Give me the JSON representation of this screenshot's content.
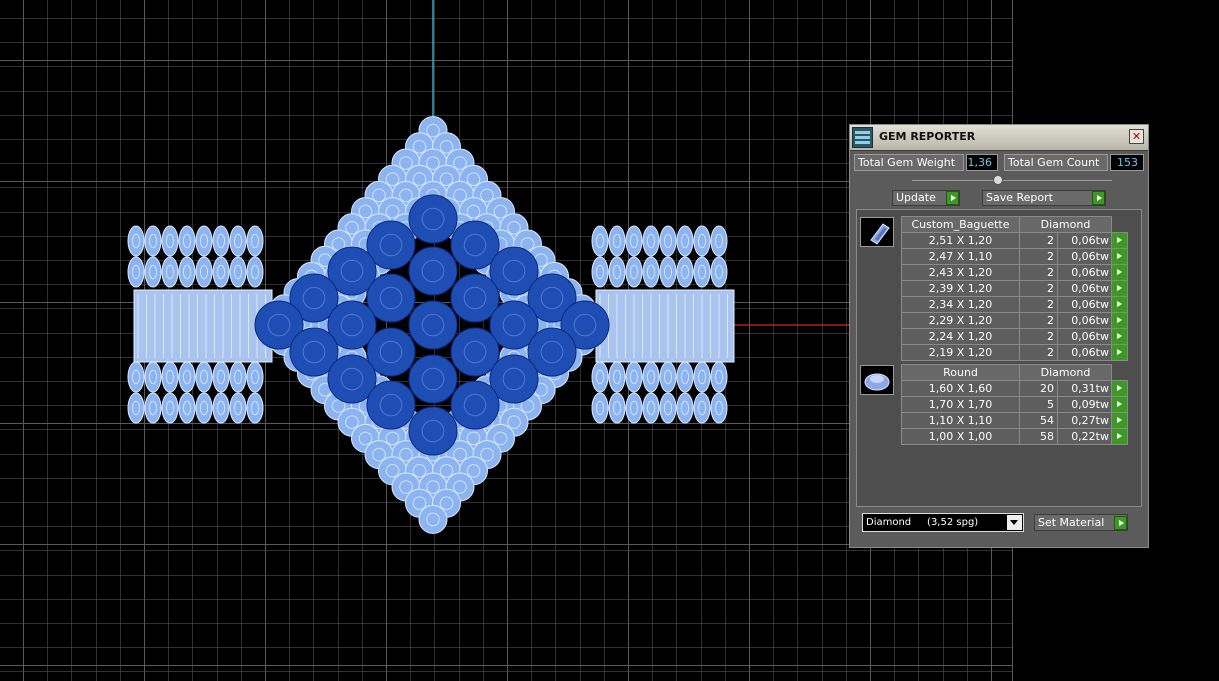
{
  "panel": {
    "title": "GEM REPORTER",
    "close_glyph": "✕",
    "total_weight_label": "Total Gem Weight",
    "total_weight_value": "1,36",
    "total_count_label": "Total Gem Count",
    "total_count_value": "153",
    "update_label": "Update",
    "save_label": "Save Report",
    "set_material_label": "Set Material",
    "material_value": "Diamond     (3,52 spg)"
  },
  "groups": [
    {
      "shape": "Custom_Baguette",
      "material": "Diamond",
      "icon": "baguette-gem-icon",
      "rows": [
        {
          "size": "2,51 X 1,20",
          "count": "2",
          "weight": "0,06tw"
        },
        {
          "size": "2,47 X 1,10",
          "count": "2",
          "weight": "0,06tw"
        },
        {
          "size": "2,43 X 1,20",
          "count": "2",
          "weight": "0,06tw"
        },
        {
          "size": "2,39 X 1,20",
          "count": "2",
          "weight": "0,06tw"
        },
        {
          "size": "2,34 X 1,20",
          "count": "2",
          "weight": "0,06tw"
        },
        {
          "size": "2,29 X 1,20",
          "count": "2",
          "weight": "0,06tw"
        },
        {
          "size": "2,24 X 1,20",
          "count": "2",
          "weight": "0,06tw"
        },
        {
          "size": "2,19 X 1,20",
          "count": "2",
          "weight": "0,06tw"
        }
      ]
    },
    {
      "shape": "Round",
      "material": "Diamond",
      "icon": "round-gem-icon",
      "rows": [
        {
          "size": "1,60 X 1,60",
          "count": "20",
          "weight": "0,31tw"
        },
        {
          "size": "1,70 X 1,70",
          "count": "5",
          "weight": "0,09tw"
        },
        {
          "size": "1,10 X 1,10",
          "count": "54",
          "weight": "0,27tw"
        },
        {
          "size": "1,00 X 1,00",
          "count": "58",
          "weight": "0,22tw"
        }
      ]
    }
  ],
  "colors": {
    "background": "#000000",
    "grid": "#5a5a5a",
    "gem_light": "#8cb4f0",
    "gem_dark": "#1e4db4",
    "axis_y": "#3aa8c8",
    "axis_x": "#b41e1e"
  }
}
